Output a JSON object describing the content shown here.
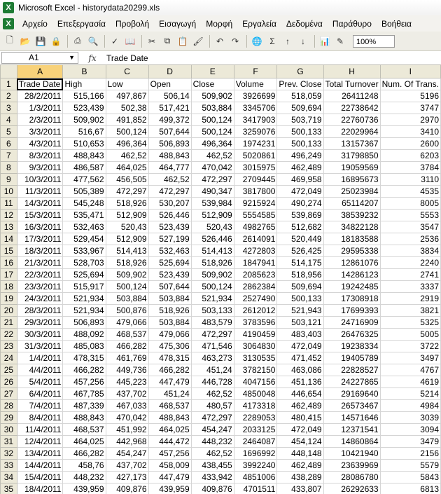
{
  "window": {
    "title": "Microsoft Excel - historydata20299.xls",
    "app_icon": "excel-icon"
  },
  "menu": [
    {
      "label": "Αρχείο"
    },
    {
      "label": "Επεξεργασία"
    },
    {
      "label": "Προβολή"
    },
    {
      "label": "Εισαγωγή"
    },
    {
      "label": "Μορφή"
    },
    {
      "label": "Εργαλεία"
    },
    {
      "label": "Δεδομένα"
    },
    {
      "label": "Παράθυρο"
    },
    {
      "label": "Βοήθεια"
    }
  ],
  "toolbar": {
    "zoom": "100%"
  },
  "formula_bar": {
    "namebox": "A1",
    "fx": "fx",
    "value": "Trade Date"
  },
  "columns": [
    "A",
    "B",
    "C",
    "D",
    "E",
    "F",
    "G",
    "H",
    "I"
  ],
  "headers": [
    "Trade Date",
    "High",
    "Low",
    "Open",
    "Close",
    "Volume",
    "Prev. Close",
    "Total Turnover",
    "Num. Of Trans."
  ],
  "rows": [
    [
      "28/2/2011",
      "515,166",
      "497,867",
      "506,14",
      "509,902",
      "3926699",
      "518,059",
      "26411248",
      "5196"
    ],
    [
      "1/3/2011",
      "523,439",
      "502,38",
      "517,421",
      "503,884",
      "3345706",
      "509,694",
      "22738642",
      "3747"
    ],
    [
      "2/3/2011",
      "509,902",
      "491,852",
      "499,372",
      "500,124",
      "3417903",
      "503,719",
      "22760736",
      "2970"
    ],
    [
      "3/3/2011",
      "516,67",
      "500,124",
      "507,644",
      "500,124",
      "3259076",
      "500,133",
      "22029964",
      "3410"
    ],
    [
      "4/3/2011",
      "510,653",
      "496,364",
      "506,893",
      "496,364",
      "1974231",
      "500,133",
      "13157367",
      "2600"
    ],
    [
      "8/3/2011",
      "488,843",
      "462,52",
      "488,843",
      "462,52",
      "5020861",
      "496,249",
      "31798850",
      "6203"
    ],
    [
      "9/3/2011",
      "486,587",
      "464,025",
      "464,777",
      "470,042",
      "3015975",
      "462,489",
      "19059569",
      "3784"
    ],
    [
      "10/3/2011",
      "477,562",
      "456,505",
      "462,52",
      "472,297",
      "2709445",
      "469,958",
      "16895673",
      "3110"
    ],
    [
      "11/3/2011",
      "505,389",
      "472,297",
      "472,297",
      "490,347",
      "3817800",
      "472,049",
      "25023984",
      "4535"
    ],
    [
      "14/3/2011",
      "545,248",
      "518,926",
      "530,207",
      "539,984",
      "9215924",
      "490,274",
      "65114207",
      "8005"
    ],
    [
      "15/3/2011",
      "535,471",
      "512,909",
      "526,446",
      "512,909",
      "5554585",
      "539,869",
      "38539232",
      "5553"
    ],
    [
      "16/3/2011",
      "532,463",
      "520,43",
      "523,439",
      "520,43",
      "4982765",
      "512,682",
      "34822128",
      "3547"
    ],
    [
      "17/3/2011",
      "529,454",
      "512,909",
      "527,199",
      "526,446",
      "2614091",
      "520,449",
      "18183588",
      "2536"
    ],
    [
      "18/3/2011",
      "533,967",
      "514,413",
      "532,463",
      "514,413",
      "4272803",
      "526,425",
      "29595338",
      "3834"
    ],
    [
      "21/3/2011",
      "528,703",
      "518,926",
      "525,694",
      "518,926",
      "1847941",
      "514,175",
      "12861076",
      "2240"
    ],
    [
      "22/3/2011",
      "525,694",
      "509,902",
      "523,439",
      "509,902",
      "2085623",
      "518,956",
      "14286123",
      "2741"
    ],
    [
      "23/3/2011",
      "515,917",
      "500,124",
      "507,644",
      "500,124",
      "2862384",
      "509,694",
      "19242485",
      "3337"
    ],
    [
      "24/3/2011",
      "521,934",
      "503,884",
      "503,884",
      "521,934",
      "2527490",
      "500,133",
      "17308918",
      "2919"
    ],
    [
      "28/3/2011",
      "521,934",
      "500,876",
      "518,926",
      "503,133",
      "2612012",
      "521,943",
      "17699393",
      "3821"
    ],
    [
      "29/3/2011",
      "506,893",
      "479,066",
      "503,884",
      "483,579",
      "3783596",
      "503,121",
      "24716909",
      "5325"
    ],
    [
      "30/3/2011",
      "488,092",
      "468,537",
      "479,066",
      "472,297",
      "4190459",
      "483,403",
      "26476325",
      "5005"
    ],
    [
      "31/3/2011",
      "485,083",
      "466,282",
      "475,306",
      "471,546",
      "3064830",
      "472,049",
      "19238334",
      "3722"
    ],
    [
      "1/4/2011",
      "478,315",
      "461,769",
      "478,315",
      "463,273",
      "3130535",
      "471,452",
      "19405789",
      "3497"
    ],
    [
      "4/4/2011",
      "466,282",
      "449,736",
      "466,282",
      "451,24",
      "3782150",
      "463,086",
      "22828527",
      "4767"
    ],
    [
      "5/4/2011",
      "457,256",
      "445,223",
      "447,479",
      "446,728",
      "4047156",
      "451,136",
      "24227865",
      "4619"
    ],
    [
      "6/4/2011",
      "467,785",
      "437,702",
      "451,24",
      "462,52",
      "4850048",
      "446,654",
      "29169640",
      "5214"
    ],
    [
      "7/4/2011",
      "487,339",
      "467,033",
      "468,537",
      "480,57",
      "4173318",
      "462,489",
      "26573467",
      "4984"
    ],
    [
      "8/4/2011",
      "488,843",
      "470,042",
      "488,843",
      "472,297",
      "2289053",
      "480,415",
      "14571646",
      "3039"
    ],
    [
      "11/4/2011",
      "468,537",
      "451,992",
      "464,025",
      "454,247",
      "2033125",
      "472,049",
      "12371541",
      "3094"
    ],
    [
      "12/4/2011",
      "464,025",
      "442,968",
      "444,472",
      "448,232",
      "2464087",
      "454,124",
      "14860864",
      "3479"
    ],
    [
      "13/4/2011",
      "466,282",
      "454,247",
      "457,256",
      "462,52",
      "1696992",
      "448,148",
      "10421940",
      "2156"
    ],
    [
      "14/4/2011",
      "458,76",
      "437,702",
      "458,009",
      "438,455",
      "3992240",
      "462,489",
      "23639969",
      "5579"
    ],
    [
      "15/4/2011",
      "448,232",
      "427,173",
      "447,479",
      "433,942",
      "4851006",
      "438,289",
      "28086780",
      "5843"
    ],
    [
      "18/4/2011",
      "439,959",
      "409,876",
      "439,959",
      "409,876",
      "4701511",
      "433,807",
      "26292633",
      "6813"
    ]
  ]
}
